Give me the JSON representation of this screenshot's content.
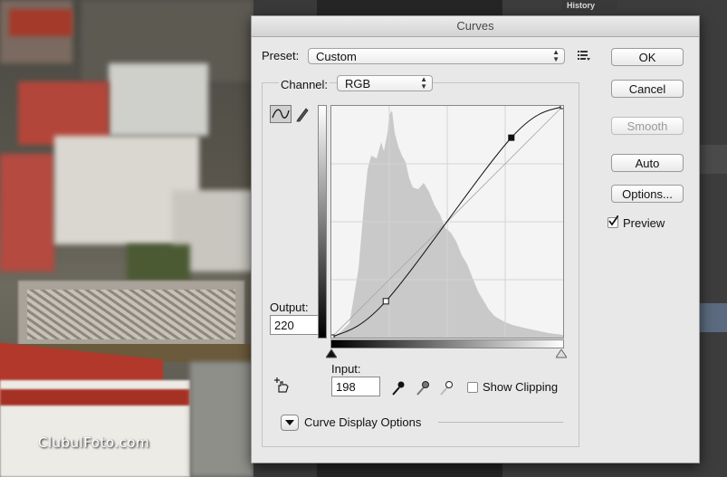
{
  "dialog": {
    "title": "Curves",
    "preset_label": "Preset:",
    "preset_value": "Custom",
    "channel_label": "Channel:",
    "channel_value": "RGB",
    "output_label": "Output:",
    "output_value": "220",
    "input_label": "Input:",
    "input_value": "198",
    "show_clipping_label": "Show Clipping",
    "curve_display_options_label": "Curve Display Options",
    "preview_label": "Preview",
    "preview_checked": true,
    "buttons": {
      "ok": "OK",
      "cancel": "Cancel",
      "smooth": "Smooth",
      "auto": "Auto",
      "options": "Options..."
    }
  },
  "panels": {
    "history_tab": "History"
  },
  "watermark": "ClubulFoto.com",
  "curve": {
    "points": [
      [
        0,
        0
      ],
      [
        60,
        40
      ],
      [
        198,
        220
      ],
      [
        255,
        255
      ]
    ]
  },
  "icons": {
    "curve_tool": "curve-icon",
    "pencil_tool": "pencil-icon",
    "presets_menu": "list-menu-icon",
    "on_image_adjust": "hand-adjust-icon",
    "black_eyedropper": "eyedropper-icon",
    "gray_eyedropper": "eyedropper-icon",
    "white_eyedropper": "eyedropper-icon",
    "expand": "triangle-down-icon"
  }
}
